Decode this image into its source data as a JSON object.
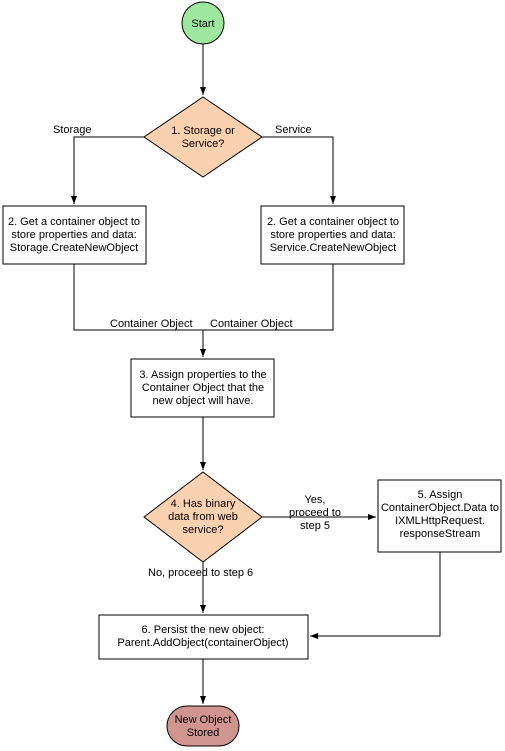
{
  "chart_data": {
    "type": "flowchart",
    "nodes": [
      {
        "id": "start",
        "type": "start",
        "label": "Start"
      },
      {
        "id": "d1",
        "type": "decision",
        "label": "1. Storage or Service?"
      },
      {
        "id": "p2a",
        "type": "process",
        "label": "2. Get a container object to store properties and data: Storage.CreateNewObject"
      },
      {
        "id": "p2b",
        "type": "process",
        "label": "2. Get a container object to store properties and data: Service.CreateNewObject"
      },
      {
        "id": "p3",
        "type": "process",
        "label": "3. Assign properties to the Container Object that the new object will have."
      },
      {
        "id": "d4",
        "type": "decision",
        "label": "4. Has binary data from web service?"
      },
      {
        "id": "p5",
        "type": "process",
        "label": "5. Assign ContainerObject.Data to IXMLHttpRequest. responseStream"
      },
      {
        "id": "p6",
        "type": "process",
        "label": "6. Persist the new object: Parent.AddObject(containerObject)"
      },
      {
        "id": "end",
        "type": "terminator",
        "label": "New Object Stored"
      }
    ],
    "edges": [
      {
        "from": "start",
        "to": "d1",
        "label": ""
      },
      {
        "from": "d1",
        "to": "p2a",
        "label": "Storage"
      },
      {
        "from": "d1",
        "to": "p2b",
        "label": "Service"
      },
      {
        "from": "p2a",
        "to": "p3",
        "label": "Container Object"
      },
      {
        "from": "p2b",
        "to": "p3",
        "label": "Container Object"
      },
      {
        "from": "p3",
        "to": "d4",
        "label": ""
      },
      {
        "from": "d4",
        "to": "p5",
        "label": "Yes, proceed to step 5"
      },
      {
        "from": "d4",
        "to": "p6",
        "label": "No, proceed to step 6"
      },
      {
        "from": "p5",
        "to": "p6",
        "label": ""
      },
      {
        "from": "p6",
        "to": "end",
        "label": ""
      }
    ]
  },
  "nodes": {
    "start": "Start",
    "d1_l1": "1. Storage or",
    "d1_l2": "Service?",
    "p2a_l1": "2. Get a container object to",
    "p2a_l2": "store properties and data:",
    "p2a_l3": "Storage.CreateNewObject",
    "p2b_l1": "2. Get a container object to",
    "p2b_l2": "store properties and data:",
    "p2b_l3": "Service.CreateNewObject",
    "p3_l1": "3. Assign properties to the",
    "p3_l2": "Container Object that the",
    "p3_l3": "new object will have.",
    "d4_l1": "4. Has binary",
    "d4_l2": "data from web",
    "d4_l3": "service?",
    "p5_l1": "5. Assign",
    "p5_l2": "ContainerObject.Data to",
    "p5_l3": "IXMLHttpRequest.",
    "p5_l4": "responseStream",
    "p6_l1": "6. Persist the new object:",
    "p6_l2": "Parent.AddObject(containerObject)",
    "end_l1": "New Object",
    "end_l2": "Stored"
  },
  "edges": {
    "storage": "Storage",
    "service": "Service",
    "co1": "Container Object",
    "co2": "Container Object",
    "yes_l1": "Yes,",
    "yes_l2": "proceed to",
    "yes_l3": "step 5",
    "no": "No, proceed to step 6"
  }
}
